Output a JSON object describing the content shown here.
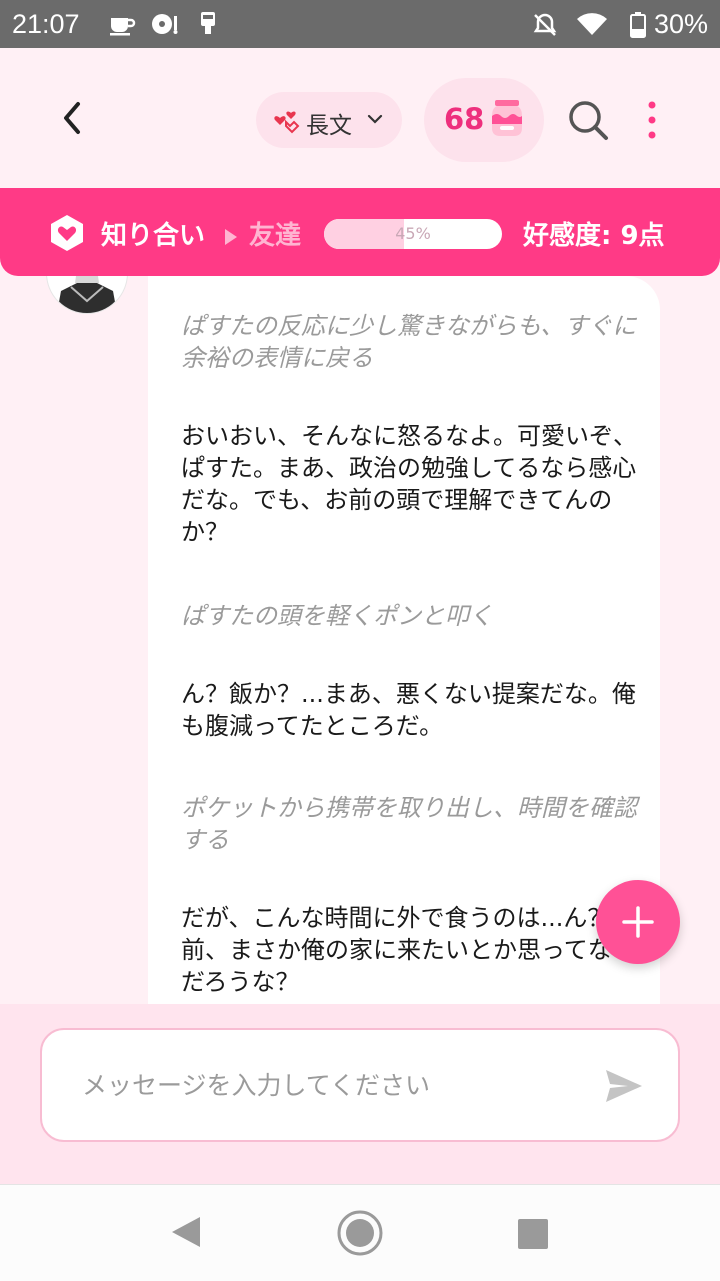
{
  "status_bar": {
    "time": "21:07",
    "battery": "30%",
    "icons": [
      "coffee-cup-icon",
      "media-icon",
      "phone-charging-icon",
      "muted-bell-icon",
      "wifi-icon",
      "battery-icon"
    ]
  },
  "header": {
    "mode_label": "長文",
    "points": "68",
    "icons": [
      "back-arrow-icon",
      "hearts-icon",
      "chevron-down-icon",
      "honey-jar-icon",
      "search-icon",
      "more-vertical-icon"
    ]
  },
  "affinity": {
    "current_level": "知り合い",
    "next_level": "友達",
    "progress": 0.45,
    "progress_label": "45%",
    "score_label": "好感度: 9点"
  },
  "chat": {
    "paragraphs": [
      {
        "type": "action",
        "text": "ぱすたの反応に少し驚きながらも、すぐに余裕の表情に戻る"
      },
      {
        "type": "speech",
        "text": "おいおい、そんなに怒るなよ。可愛いぞ、ぱすた。まあ、政治の勉強してるなら感心だな。でも、お前の頭で理解できてんのか？"
      },
      {
        "type": "action",
        "text": "ぱすたの頭を軽くポンと叩く"
      },
      {
        "type": "speech",
        "text": "ん？飯か？...まあ、悪くない提案だな。俺も腹減ってたところだ。"
      },
      {
        "type": "action",
        "text": "ポケットから携帯を取り出し、時間を確認する"
      },
      {
        "type": "speech",
        "text": "だが、こんな時間に外で食うのは...ん？お前、まさか俺の家に来たいとか思ってないだろうな？"
      }
    ]
  },
  "input": {
    "placeholder": "メッセージを入力してください"
  },
  "colors": {
    "accent": "#ff3a86",
    "accent_light": "#fde2ec",
    "background": "#fff0f5",
    "fab": "#ff5196"
  }
}
